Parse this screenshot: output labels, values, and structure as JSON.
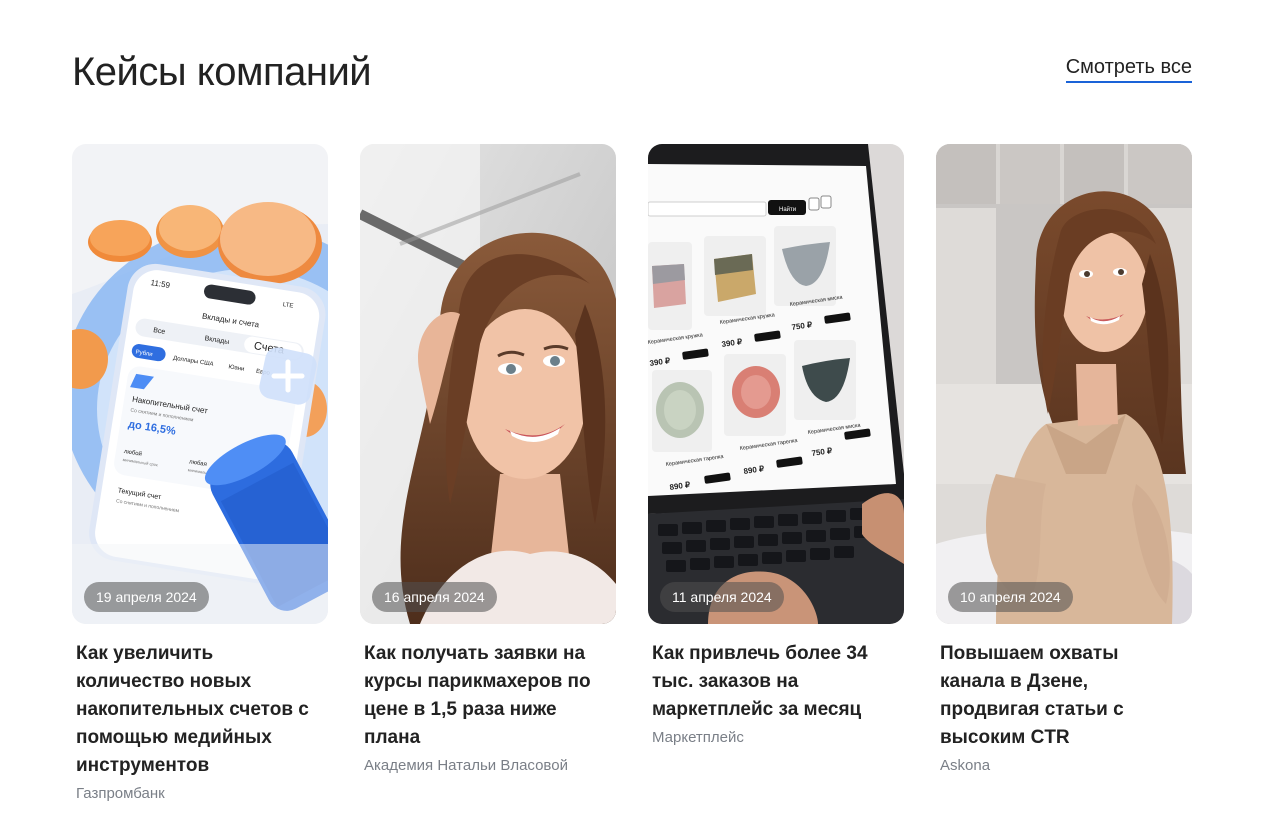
{
  "header": {
    "title": "Кейсы компаний",
    "see_all_label": "Смотреть все"
  },
  "colors": {
    "accent": "#1a63d8",
    "text": "#222222",
    "muted": "#7a7f87"
  },
  "cards": [
    {
      "date": "19 апреля 2024",
      "title": "Как увеличить количество новых накопительных счетов с помощью медийных инструментов",
      "company": "Газпромбанк",
      "image": "banking-app-phone-illustration",
      "phone": {
        "time": "11:59",
        "signal": "LTE",
        "screen_title": "Вклады и счета",
        "tabs": [
          "Все",
          "Вклады",
          "Счета"
        ],
        "chips": [
          "Рубли",
          "Доллары США",
          "Юани",
          "Евро"
        ],
        "account_title": "Накопительный счет",
        "account_sub": "Со снятием и пополнением",
        "rate": "до 16,5%",
        "term_label": "любой",
        "term_sub": "минимальный срок",
        "sum_label": "любая",
        "sum_sub": "минимальная сумма",
        "current_title": "Текущий счет",
        "current_sub": "Со снятием и пополнением"
      }
    },
    {
      "date": "16 апреля 2024",
      "title": "Как получать заявки на курсы парикмахеров по цене в 1,5 раза ниже плана",
      "company": "Академия Натальи Власовой",
      "image": "smiling-woman-photo"
    },
    {
      "date": "11 апреля 2024",
      "title": "Как привлечь более 34 тыс. заказов на маркетплейс за месяц",
      "company": "Маркетплейс",
      "image": "laptop-marketplace-photo",
      "laptop": {
        "search_button": "Найти",
        "products": [
          {
            "name": "Керамическая кружка",
            "brand": "Ceramics",
            "price": "390 ₽",
            "button": "В корзину"
          },
          {
            "name": "Керамическая кружка",
            "brand": "Ceramics",
            "price": "390 ₽",
            "button": "В корзину"
          },
          {
            "name": "Керамическая миска",
            "brand": "Ceramics",
            "price": "750 ₽",
            "button": "В корзину"
          },
          {
            "name": "Керамическая тарелка",
            "brand": "Ceramics",
            "price": "890 ₽",
            "button": "В корзину"
          },
          {
            "name": "Керамическая тарелка",
            "brand": "Ceramics",
            "price": "890 ₽",
            "button": "В корзину"
          },
          {
            "name": "Керамическая миска",
            "brand": "Ceramics",
            "price": "750 ₽",
            "button": "В корзину"
          }
        ]
      }
    },
    {
      "date": "10 апреля 2024",
      "title": "Повышаем охваты канала в Дзене, продвигая статьи с высоким CTR",
      "company": "Askona",
      "image": "woman-on-bed-photo"
    }
  ]
}
